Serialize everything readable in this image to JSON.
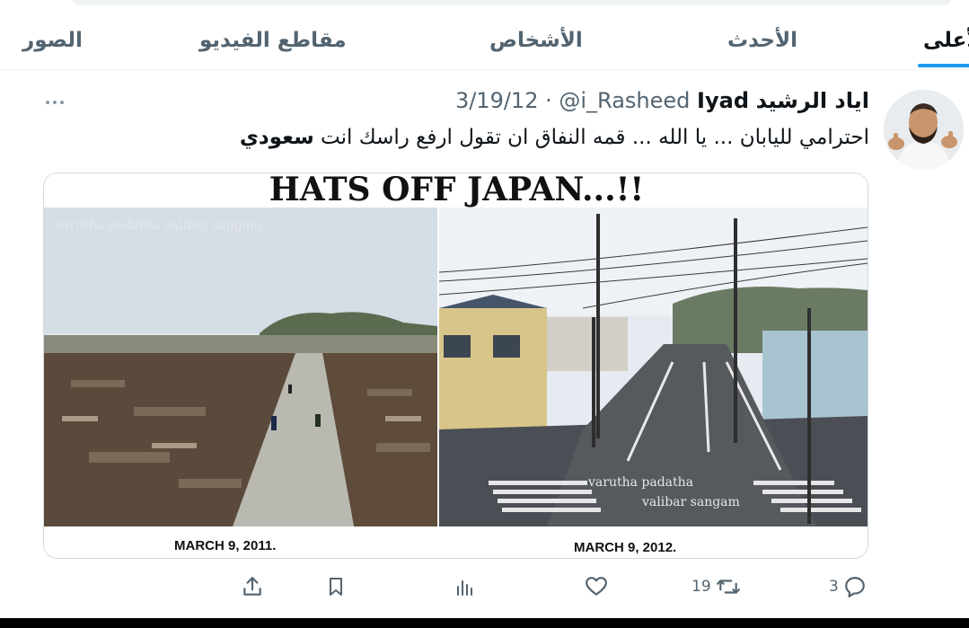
{
  "tabs": [
    {
      "label": "الأعلى",
      "active": true
    },
    {
      "label": "الأحدث"
    },
    {
      "label": "الأشخاص"
    },
    {
      "label": "مقاطع الفيديو"
    },
    {
      "label": "الصور"
    }
  ],
  "tweet": {
    "author_name_ar": "اياد الرشيد",
    "author_name_en": "Iyad",
    "handle": "@i_Rasheed",
    "separator": "·",
    "date": "3/19/12",
    "text_main": "احترامي لليابان ... يا الله ... قمه النفاق ان تقول ارفع راسك انت ",
    "text_bold": "سعودي",
    "media": {
      "title": "HATS OFF JAPAN...!!",
      "watermark_left": "varutha padatha valibar sangam",
      "watermark_right_line1": "varutha padatha",
      "watermark_right_line2": "valibar sangam",
      "caption_left": "MARCH 9, 2011.",
      "caption_right": "MARCH 9, 2012."
    },
    "counts": {
      "replies": "3",
      "retweets": "19"
    }
  },
  "icons": {
    "more": "more-icon",
    "reply": "reply-icon",
    "retweet": "retweet-icon",
    "like": "heart-icon",
    "views": "views-icon",
    "bookmark": "bookmark-icon",
    "share": "share-icon"
  },
  "colors": {
    "accent": "#1d9bf0",
    "secondary_text": "#536471",
    "primary_text": "#0f1419"
  }
}
